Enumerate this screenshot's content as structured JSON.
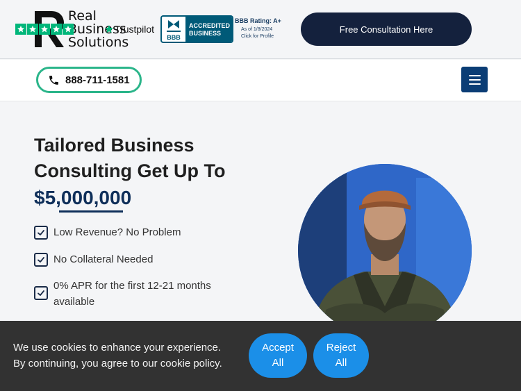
{
  "brand": {
    "name_line1": "Real",
    "name_line2": "Business",
    "name_line3": "Solutions"
  },
  "trustpilot": {
    "label": "Trustpilot",
    "color": "#00b67a"
  },
  "bbb": {
    "seal_text": "BBB",
    "accredited_line1": "ACCREDITED",
    "accredited_line2": "BUSINESS",
    "rating": "BBB Rating: A+",
    "as_of": "As of 1/8/2024",
    "profile_link": "Click for Profile"
  },
  "header": {
    "cta_label": "Free Consultation Here",
    "cta_color": "#14213d"
  },
  "nav": {
    "phone": "888-711-1581",
    "phone_icon": "phone-icon",
    "menu_icon": "hamburger-menu-icon",
    "accent": "#2bb58a"
  },
  "hero": {
    "title_line1": "Tailored Business",
    "title_line2": "Consulting Get Up To",
    "amount": "$5,000,000",
    "features": [
      {
        "text": "Low Revenue? No Problem",
        "icon": "checkbox-check-icon"
      },
      {
        "text": "No Collateral Needed",
        "icon": "checkbox-check-icon"
      },
      {
        "text": "0% APR for the first 12-21 months available",
        "icon": "checkbox-check-icon"
      }
    ]
  },
  "cookie_banner": {
    "line1": "We use cookies to enhance your experience.",
    "line2": "By continuing, you agree to our cookie policy.",
    "accept_line1": "Accept",
    "accept_line2": "All",
    "reject_line1": "Reject",
    "reject_line2": "All",
    "button_color": "#1b8fe8"
  }
}
